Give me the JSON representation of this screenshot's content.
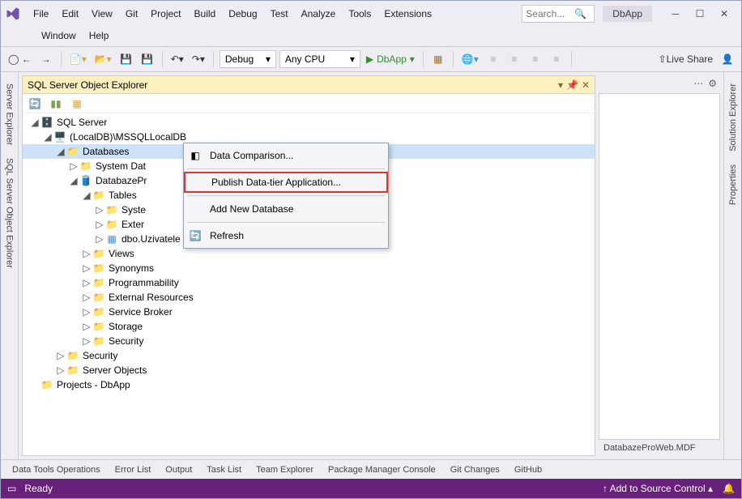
{
  "menu": {
    "file": "File",
    "edit": "Edit",
    "view": "View",
    "git": "Git",
    "project": "Project",
    "build": "Build",
    "debug": "Debug",
    "test": "Test",
    "analyze": "Analyze",
    "tools": "Tools",
    "extensions": "Extensions",
    "window": "Window",
    "help": "Help"
  },
  "search": {
    "placeholder": "Search..."
  },
  "app_name": "DbApp",
  "toolbar": {
    "config": "Debug",
    "platform": "Any CPU",
    "run": "DbApp"
  },
  "live_share": "Live Share",
  "panel": {
    "title": "SQL Server Object Explorer"
  },
  "tree": {
    "root": "SQL Server",
    "instance": "(LocalDB)\\MSSQLLocalDB",
    "databases": "Databases",
    "sysdb": "System Dat",
    "userdb": "DatabazePr",
    "tables": "Tables",
    "syste": "Syste",
    "exter": "Exter",
    "dbo": "dbo.Uzivatele",
    "views": "Views",
    "synonyms": "Synonyms",
    "prog": "Programmability",
    "extres": "External Resources",
    "broker": "Service Broker",
    "storage": "Storage",
    "security": "Security",
    "security2": "Security",
    "serverobj": "Server Objects",
    "projects": "Projects - DbApp"
  },
  "ctx": {
    "compare": "Data Comparison...",
    "publish": "Publish Data-tier Application...",
    "addnew": "Add New Database",
    "refresh": "Refresh"
  },
  "preview_label": "DatabazeProWeb.MDF",
  "sidebar_left": {
    "server": "Server Explorer",
    "sql": "SQL Server Object Explorer"
  },
  "sidebar_right": {
    "solution": "Solution Explorer",
    "props": "Properties"
  },
  "bottom": {
    "dto": "Data Tools Operations",
    "err": "Error List",
    "out": "Output",
    "task": "Task List",
    "team": "Team Explorer",
    "pmc": "Package Manager Console",
    "gitc": "Git Changes",
    "gh": "GitHub"
  },
  "status": {
    "ready": "Ready",
    "source": "Add to Source Control"
  }
}
